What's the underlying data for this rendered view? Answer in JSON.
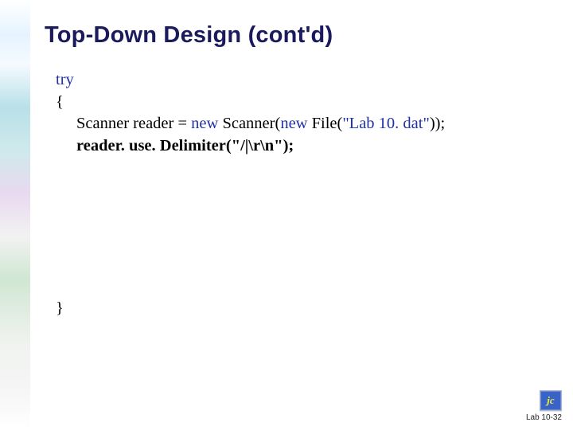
{
  "title": "Top-Down Design (cont'd)",
  "code": {
    "try_kw": "try",
    "open_brace": "{",
    "line1_a": "Scanner reader = ",
    "line1_new1": "new",
    "line1_b": " Scanner(",
    "line1_new2": "new",
    "line1_c": " File(",
    "line1_lit": "\"Lab 10. dat\"",
    "line1_d": "));",
    "line2_a": "reader. use. Delimiter(",
    "line2_lit": "\"/|\\r\\n\"",
    "line2_b": ");",
    "close_brace": "}"
  },
  "footer": {
    "icon_text": "jc",
    "slide_number": "Lab 10-32"
  }
}
